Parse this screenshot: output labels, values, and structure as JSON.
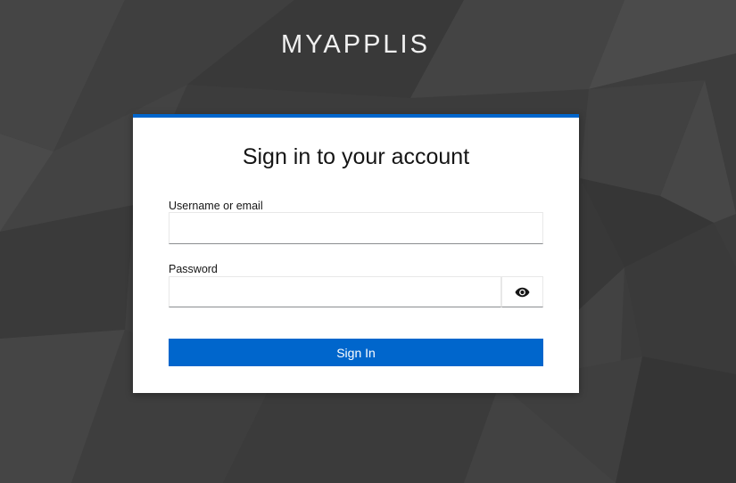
{
  "brand": {
    "title": "MYAPPLIS"
  },
  "login": {
    "heading": "Sign in to your account",
    "username_label": "Username or email",
    "username_value": "",
    "password_label": "Password",
    "password_value": "",
    "show_password_icon": "eye-icon",
    "submit_label": "Sign In"
  },
  "colors": {
    "accent": "#0066cc",
    "background": "#3a3a3a",
    "card": "#ffffff"
  }
}
